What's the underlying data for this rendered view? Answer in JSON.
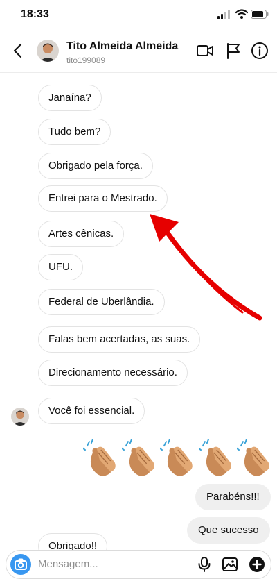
{
  "status_bar": {
    "time": "18:33"
  },
  "header": {
    "name": "Tito Almeida Almeida",
    "username": "tito199089"
  },
  "messages_in": [
    "Janaína?",
    "Tudo bem?",
    "Obrigado pela força.",
    "Entrei para o Mestrado.",
    "Artes cênicas.",
    "UFU.",
    "Federal de Uberlândia.",
    "Falas bem acertadas, as suas.",
    "Direcionamento necessário.",
    "Você foi essencial.",
    "Obrigado!!"
  ],
  "emoji_message": {
    "emoji": "👏",
    "count": 5
  },
  "messages_out": [
    "Parabéns!!!",
    "Que sucesso"
  ],
  "composer": {
    "placeholder": "Mensagem..."
  },
  "colors": {
    "accent": "#3897f0",
    "annotation_arrow": "#e60000"
  },
  "icons": [
    "back-arrow-icon",
    "video-call-icon",
    "flag-icon",
    "info-icon",
    "camera-icon",
    "microphone-icon",
    "gallery-icon",
    "plus-icon",
    "clap-emoji"
  ]
}
